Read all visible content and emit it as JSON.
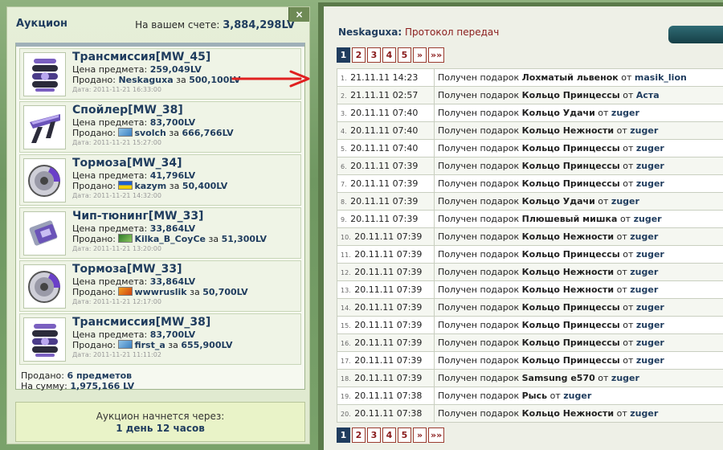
{
  "auction": {
    "title": "Аукцион",
    "balance_label": "На вашем счете:",
    "balance_value": "3,884,298LV",
    "close_label": "×",
    "price_label": "Цена предмета:",
    "sold_label": "Продано:",
    "for_label": "за",
    "date_label": "Дата:",
    "lots": [
      {
        "name": "Трансмиссия[MW_45]",
        "price": "259,049LV",
        "buyer": "Neskaguxa",
        "amount": "500,100LV",
        "date": "2011-11-21 16:33:00",
        "icon": "transmission-icon",
        "flag": ""
      },
      {
        "name": "Спойлер[MW_38]",
        "price": "83,700LV",
        "buyer": "svolch",
        "amount": "666,766LV",
        "date": "2011-11-21 15:27:00",
        "icon": "spoiler-icon",
        "flag": "flag-blue"
      },
      {
        "name": "Тормоза[MW_34]",
        "price": "41,796LV",
        "buyer": "kazym",
        "amount": "50,400LV",
        "date": "2011-11-21 14:32:00",
        "icon": "brakes-icon",
        "flag": "flag-ukraine"
      },
      {
        "name": "Чип-тюнинг[MW_33]",
        "price": "33,864LV",
        "buyer": "Kilka_B_CoyCe",
        "amount": "51,300LV",
        "date": "2011-11-21 13:20:00",
        "icon": "chip-icon",
        "flag": "flag-green"
      },
      {
        "name": "Тормоза[MW_33]",
        "price": "33,864LV",
        "buyer": "wwwruslik",
        "amount": "50,700LV",
        "date": "2011-11-21 12:17:00",
        "icon": "brakes-icon",
        "flag": "flag-orange"
      },
      {
        "name": "Трансмиссия[MW_38]",
        "price": "83,700LV",
        "buyer": "first_a",
        "amount": "655,900LV",
        "date": "2011-11-21 11:11:02",
        "icon": "transmission-icon",
        "flag": "flag-blue"
      }
    ],
    "summary_sold_label": "Продано:",
    "summary_sold_value": "6 предметов",
    "summary_sum_label": "На сумму:",
    "summary_sum_value": "1,975,166 LV",
    "start_label": "Аукцион начнется через:",
    "start_value": "1 день 12 часов"
  },
  "transfers": {
    "user": "Neskaguxa",
    "title": "Протокол передач",
    "pages": [
      "1",
      "2",
      "3",
      "4",
      "5",
      "»",
      "»»"
    ],
    "current_page": "1",
    "received_label": "Получен подарок",
    "from_label": "от",
    "rows": [
      {
        "n": "1.",
        "dt": "21.11.11 14:23",
        "gift": "Лохматый львенок",
        "from": "masik_lion"
      },
      {
        "n": "2.",
        "dt": "21.11.11 02:57",
        "gift": "Кольцо Принцессы",
        "from": "Аста"
      },
      {
        "n": "3.",
        "dt": "20.11.11 07:40",
        "gift": "Кольцо Удачи",
        "from": "zuger"
      },
      {
        "n": "4.",
        "dt": "20.11.11 07:40",
        "gift": "Кольцо Нежности",
        "from": "zuger"
      },
      {
        "n": "5.",
        "dt": "20.11.11 07:40",
        "gift": "Кольцо Принцессы",
        "from": "zuger"
      },
      {
        "n": "6.",
        "dt": "20.11.11 07:39",
        "gift": "Кольцо Принцессы",
        "from": "zuger"
      },
      {
        "n": "7.",
        "dt": "20.11.11 07:39",
        "gift": "Кольцо Принцессы",
        "from": "zuger"
      },
      {
        "n": "8.",
        "dt": "20.11.11 07:39",
        "gift": "Кольцо Удачи",
        "from": "zuger"
      },
      {
        "n": "9.",
        "dt": "20.11.11 07:39",
        "gift": "Плюшевый мишка",
        "from": "zuger"
      },
      {
        "n": "10.",
        "dt": "20.11.11 07:39",
        "gift": "Кольцо Нежности",
        "from": "zuger"
      },
      {
        "n": "11.",
        "dt": "20.11.11 07:39",
        "gift": "Кольцо Принцессы",
        "from": "zuger"
      },
      {
        "n": "12.",
        "dt": "20.11.11 07:39",
        "gift": "Кольцо Нежности",
        "from": "zuger"
      },
      {
        "n": "13.",
        "dt": "20.11.11 07:39",
        "gift": "Кольцо Нежности",
        "from": "zuger"
      },
      {
        "n": "14.",
        "dt": "20.11.11 07:39",
        "gift": "Кольцо Принцессы",
        "from": "zuger"
      },
      {
        "n": "15.",
        "dt": "20.11.11 07:39",
        "gift": "Кольцо Принцессы",
        "from": "zuger"
      },
      {
        "n": "16.",
        "dt": "20.11.11 07:39",
        "gift": "Кольцо Принцессы",
        "from": "zuger"
      },
      {
        "n": "17.",
        "dt": "20.11.11 07:39",
        "gift": "Кольцо Принцессы",
        "from": "zuger"
      },
      {
        "n": "18.",
        "dt": "20.11.11 07:39",
        "gift": "Samsung e570",
        "from": "zuger"
      },
      {
        "n": "19.",
        "dt": "20.11.11 07:38",
        "gift": "Рысь",
        "from": "zuger"
      },
      {
        "n": "20.",
        "dt": "20.11.11 07:38",
        "gift": "Кольцо Нежности",
        "from": "zuger"
      }
    ]
  },
  "colors": {
    "accent": "#1f3c5e",
    "link_red": "#8a1c1c",
    "arrow": "#e02020",
    "panel_green": "#5b7a4a"
  }
}
